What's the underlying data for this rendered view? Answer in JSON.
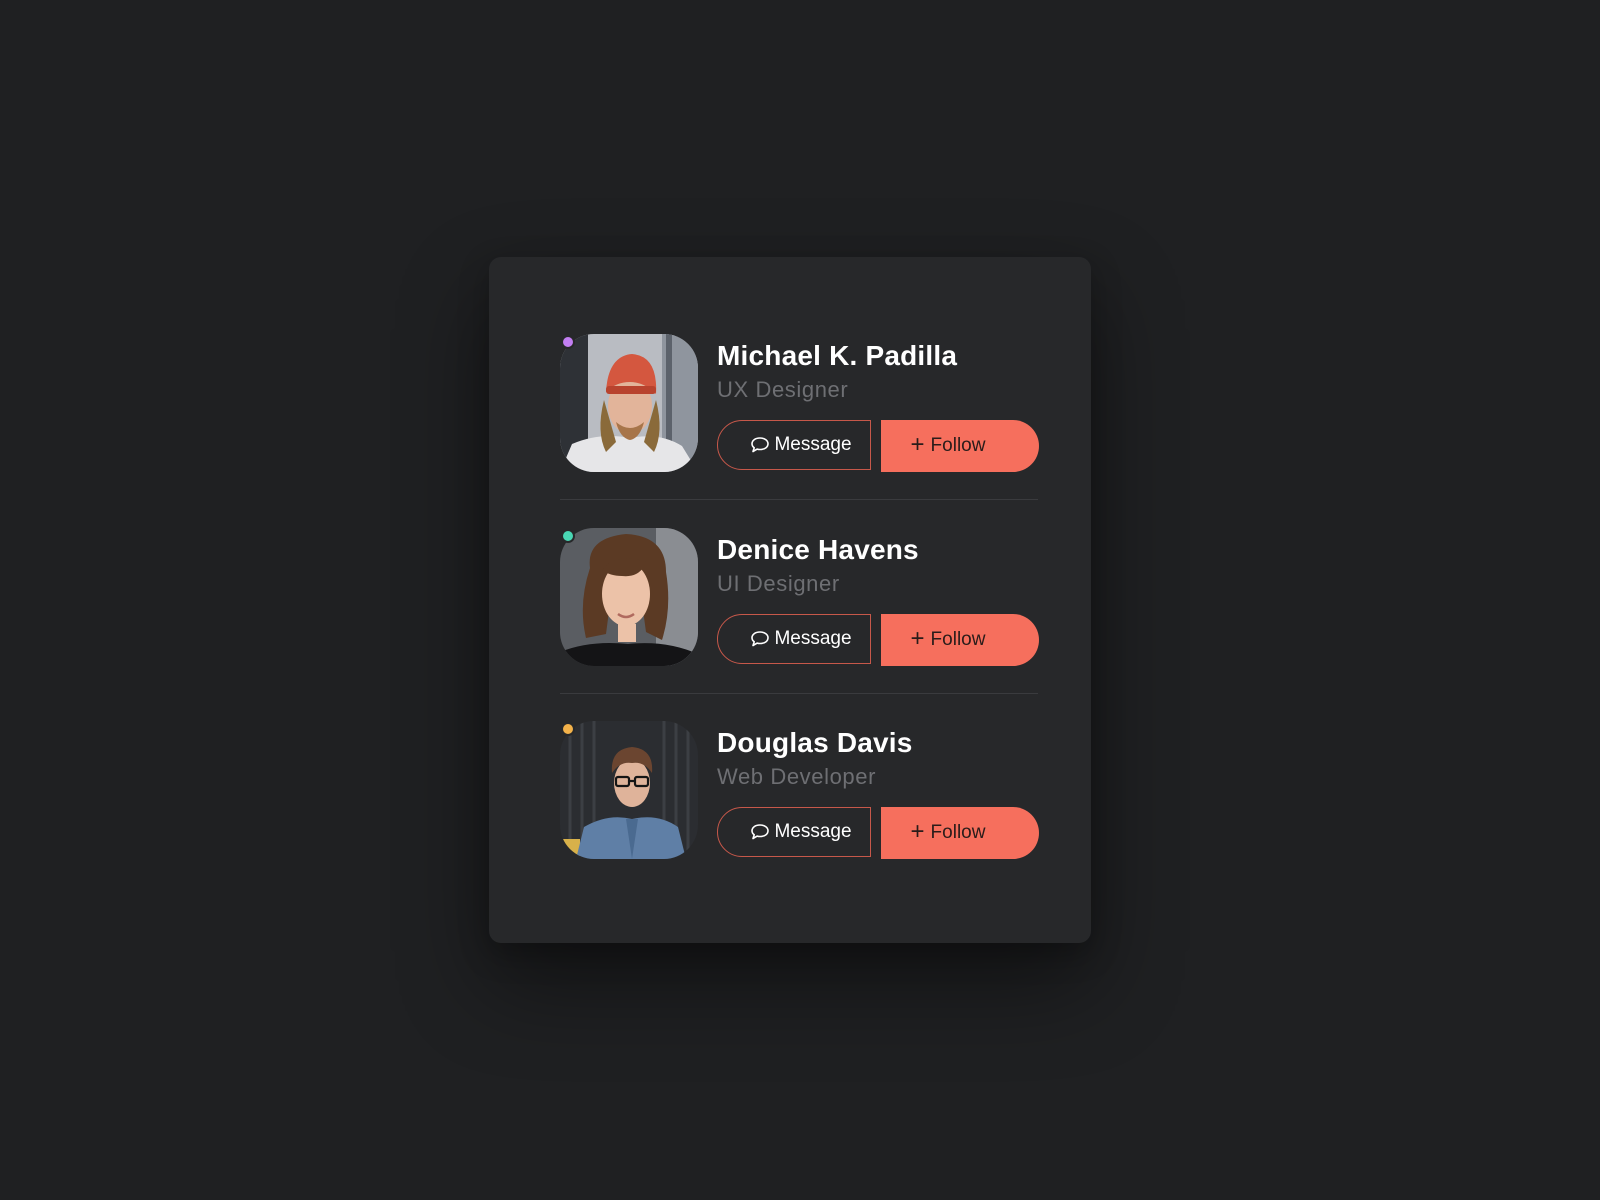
{
  "users": [
    {
      "name": "Michael K. Padilla",
      "role": "UX Designer",
      "status_color": "#c27ef2",
      "message_label": "Message",
      "follow_label": "Follow",
      "follow_icon": "+"
    },
    {
      "name": "Denice Havens",
      "role": "UI Designer",
      "status_color": "#49d7b4",
      "message_label": "Message",
      "follow_label": "Follow",
      "follow_icon": "+"
    },
    {
      "name": "Douglas Davis",
      "role": "Web Developer",
      "status_color": "#f3b24a",
      "message_label": "Message",
      "follow_label": "Follow",
      "follow_icon": "+"
    }
  ],
  "colors": {
    "background": "#1f2022",
    "card": "#27282a",
    "accent": "#f66f5d",
    "name_text": "#ffffff",
    "role_text": "#6e6f73",
    "divider": "#3a3b3e"
  },
  "icons": {
    "message": "chat-bubble-icon",
    "follow": "plus-icon"
  }
}
